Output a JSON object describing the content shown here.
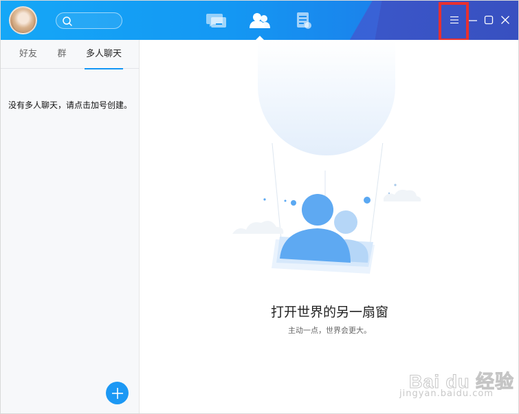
{
  "sidebar": {
    "tabs": [
      {
        "label": "好友"
      },
      {
        "label": "群"
      },
      {
        "label": "多人聊天"
      }
    ],
    "active_tab": "多人聊天",
    "empty_message": "没有多人聊天，请点击加号创建。",
    "add_button_icon": "plus-icon"
  },
  "main": {
    "headline": "打开世界的另一扇窗",
    "subline": "主动一点，世界会更大。"
  },
  "watermark": {
    "text": "Bai du 经验",
    "sub": "jingyan.baidu.com"
  },
  "colors": {
    "titlebar_start": "#15a7f7",
    "titlebar_end": "#3b5fd1",
    "accent": "#1296f5",
    "highlight_box": "#e8302f"
  },
  "icons": {
    "nav": [
      "chat-bubbles-icon",
      "contacts-icon",
      "documents-icon"
    ],
    "window": [
      "menu-icon",
      "minimize-icon",
      "maximize-icon",
      "close-icon"
    ],
    "search": "search-icon"
  }
}
